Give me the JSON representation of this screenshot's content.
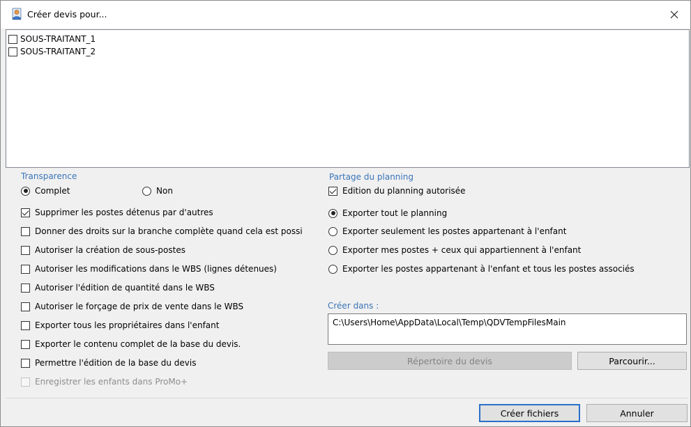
{
  "window": {
    "title": "Créer devis pour...",
    "app_icon": "user-document-icon",
    "close_icon": "close-icon"
  },
  "list": {
    "items": [
      {
        "label": "SOUS-TRAITANT_1",
        "checked": false
      },
      {
        "label": "SOUS-TRAITANT_2",
        "checked": false
      }
    ]
  },
  "transparence": {
    "title": "Transparence",
    "options": [
      {
        "label": "Complet",
        "selected": true
      },
      {
        "label": "Non",
        "selected": false
      }
    ]
  },
  "options": {
    "supprimer": {
      "label": "Supprimer les postes détenus par d'autres",
      "checked": true
    },
    "droits": {
      "label": "Donner des droits sur la branche complète quand cela est possi",
      "checked": false
    },
    "sous_postes": {
      "label": "Autoriser la création de sous-postes",
      "checked": false
    },
    "modif_wbs": {
      "label": "Autoriser les modifications dans le WBS (lignes détenues)",
      "checked": false
    },
    "quantite": {
      "label": "Autoriser l'édition de quantité dans le WBS",
      "checked": false
    },
    "forcage": {
      "label": "Autoriser le forçage de prix de vente dans le WBS",
      "checked": false
    },
    "proprietaires": {
      "label": "Exporter tous les propriétaires dans l'enfant",
      "checked": false
    },
    "contenu": {
      "label": "Exporter le contenu complet de la base du devis.",
      "checked": false
    },
    "edition_base": {
      "label": "Permettre l'édition de la base du devis",
      "checked": false
    },
    "promo": {
      "label": "Enregistrer les enfants dans ProMo+",
      "checked": false,
      "disabled": true
    }
  },
  "planning": {
    "title": "Partage du planning",
    "edition": {
      "label": "Edition du planning autorisée",
      "checked": true
    },
    "radios": [
      {
        "label": "Exporter tout le planning",
        "selected": true
      },
      {
        "label": "Exporter seulement les postes appartenant à l'enfant",
        "selected": false
      },
      {
        "label": "Exporter mes postes + ceux qui appartiennent à l'enfant",
        "selected": false
      },
      {
        "label": "Exporter les postes appartenant à l'enfant et tous les postes associés",
        "selected": false
      }
    ]
  },
  "creer_dans": {
    "label": "Créer dans :",
    "path": "C:\\Users\\Home\\AppData\\Local\\Temp\\QDVTempFilesMain",
    "repertoire_button": "Répertoire du devis",
    "parcourir_button": "Parcourir..."
  },
  "footer": {
    "create_button": "Créer fichiers",
    "cancel_button": "Annuler"
  }
}
